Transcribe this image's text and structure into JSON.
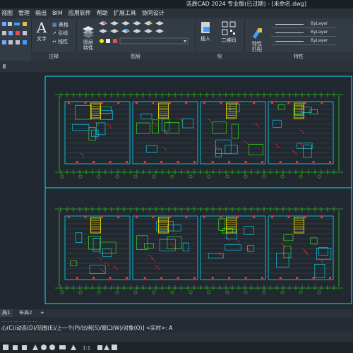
{
  "title": "浩辰CAD 2024 专业版(已过期) - [未命名.dwg]",
  "menu": [
    "视图",
    "管理",
    "输出",
    "BIM",
    "应用软件",
    "帮助",
    "扩展工具",
    "协同设计"
  ],
  "ribbon": {
    "annotate": {
      "text_label": "文字",
      "table_label": "表格",
      "leader_label": "引线",
      "linear_label": "线性",
      "panel_label": "注释"
    },
    "layers": {
      "props_label": "图层\n特性",
      "panel_label": "图层"
    },
    "block": {
      "insert_label": "插入",
      "qrcode_label": "二维码",
      "panel_label": "块"
    },
    "props": {
      "match_label": "特性\n匹配",
      "bylayer1": "ByLayer",
      "bylayer2": "ByLayer",
      "bylayer3": "ByLayer",
      "panel_label": "特性"
    }
  },
  "tabs": {
    "layout1": "局1",
    "layout2": "布局2",
    "add": "+"
  },
  "command": {
    "history": "... ... ... ... ... ...",
    "line": "心(C)/动态(D)/范围(E)/上一个(P)/比例(S)/窗口(W)/对象(O)] <实时>: A"
  },
  "status": {
    "scale": "1:1"
  },
  "colors": {
    "accent": "#3aa0ff",
    "cyan": "#00e5ff",
    "green": "#39ff14",
    "red": "#ff2a2a",
    "yellow": "#ffe600"
  }
}
